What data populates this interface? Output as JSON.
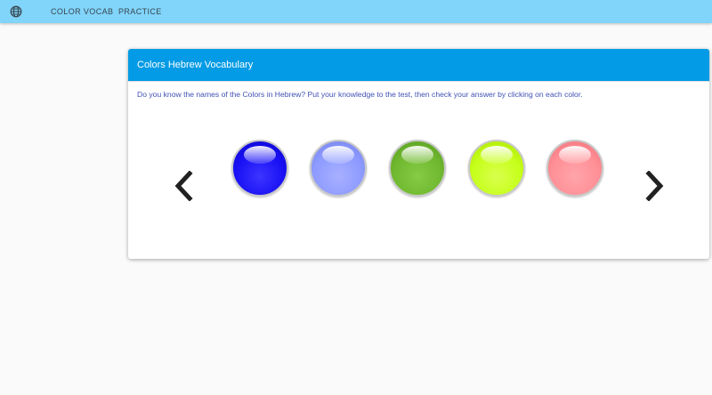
{
  "nav": {
    "globe_icon": "globe-icon",
    "items": [
      {
        "label": "COLOR VOCAB"
      },
      {
        "label": "PRACTICE"
      }
    ]
  },
  "card": {
    "title": "Colors Hebrew Vocabulary",
    "instructions": "Do you know the names of the Colors in Hebrew? Put your knowledge to the test, then check your answer by clicking on each color.",
    "prev_icon": "chevron-left-icon",
    "next_icon": "chevron-right-icon"
  },
  "colors": {
    "header_bg": "#039be5",
    "topbar_bg": "#81d4fa",
    "balls": [
      "#1a10f5",
      "#8e9bff",
      "#6fb82f",
      "#c6ff1a",
      "#ff8f96"
    ]
  }
}
